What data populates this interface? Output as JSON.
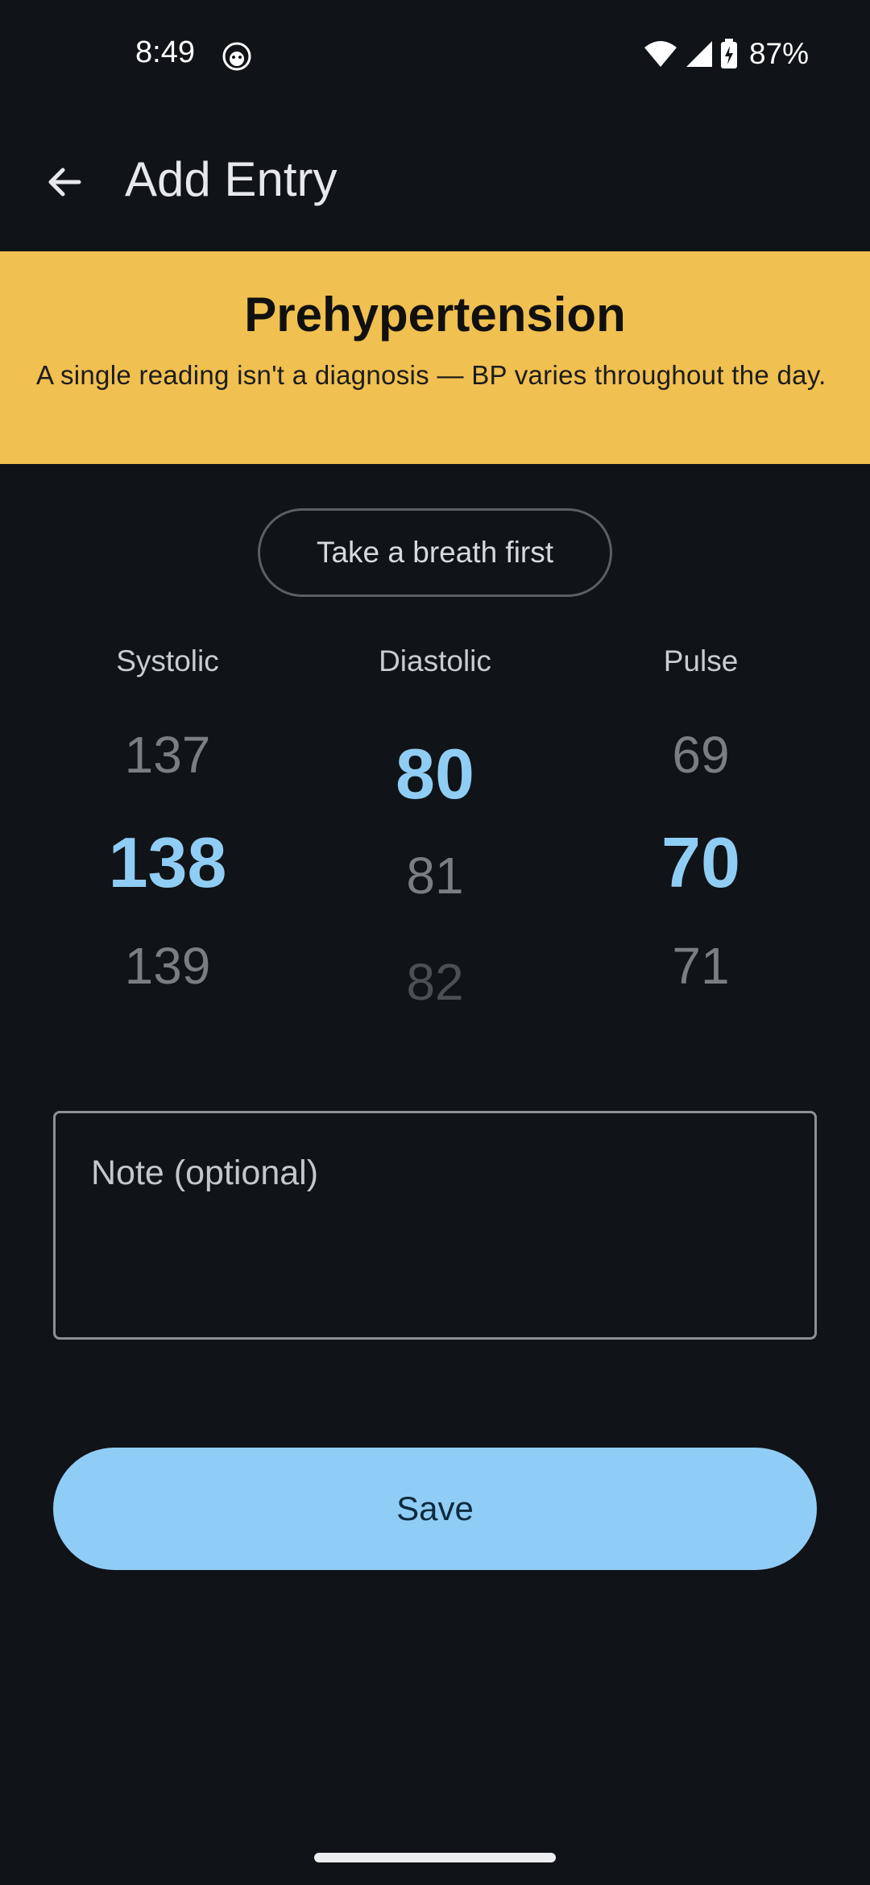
{
  "status_bar": {
    "time": "8:49",
    "battery_percent": "87%",
    "icons": [
      "app-notification-icon",
      "wifi-icon",
      "cell-signal-icon",
      "battery-charging-icon"
    ]
  },
  "app_bar": {
    "title": "Add Entry",
    "back_icon": "arrow-back-icon"
  },
  "banner": {
    "title": "Prehypertension",
    "message": "A single reading isn't a diagnosis — BP varies throughout the day.",
    "color": "#f0c050"
  },
  "breath_button": {
    "label": "Take a breath first"
  },
  "pickers": {
    "systolic": {
      "label": "Systolic",
      "above": "137",
      "selected": "138",
      "below": "139"
    },
    "diastolic": {
      "label": "Diastolic",
      "selected": "80",
      "below": "81",
      "below2": "82"
    },
    "pulse": {
      "label": "Pulse",
      "above": "69",
      "selected": "70",
      "below": "71"
    }
  },
  "note": {
    "placeholder": "Note (optional)",
    "value": ""
  },
  "save_button": {
    "label": "Save",
    "color": "#90cdf6"
  },
  "colors": {
    "background": "#101317",
    "accent": "#90cdf4"
  }
}
